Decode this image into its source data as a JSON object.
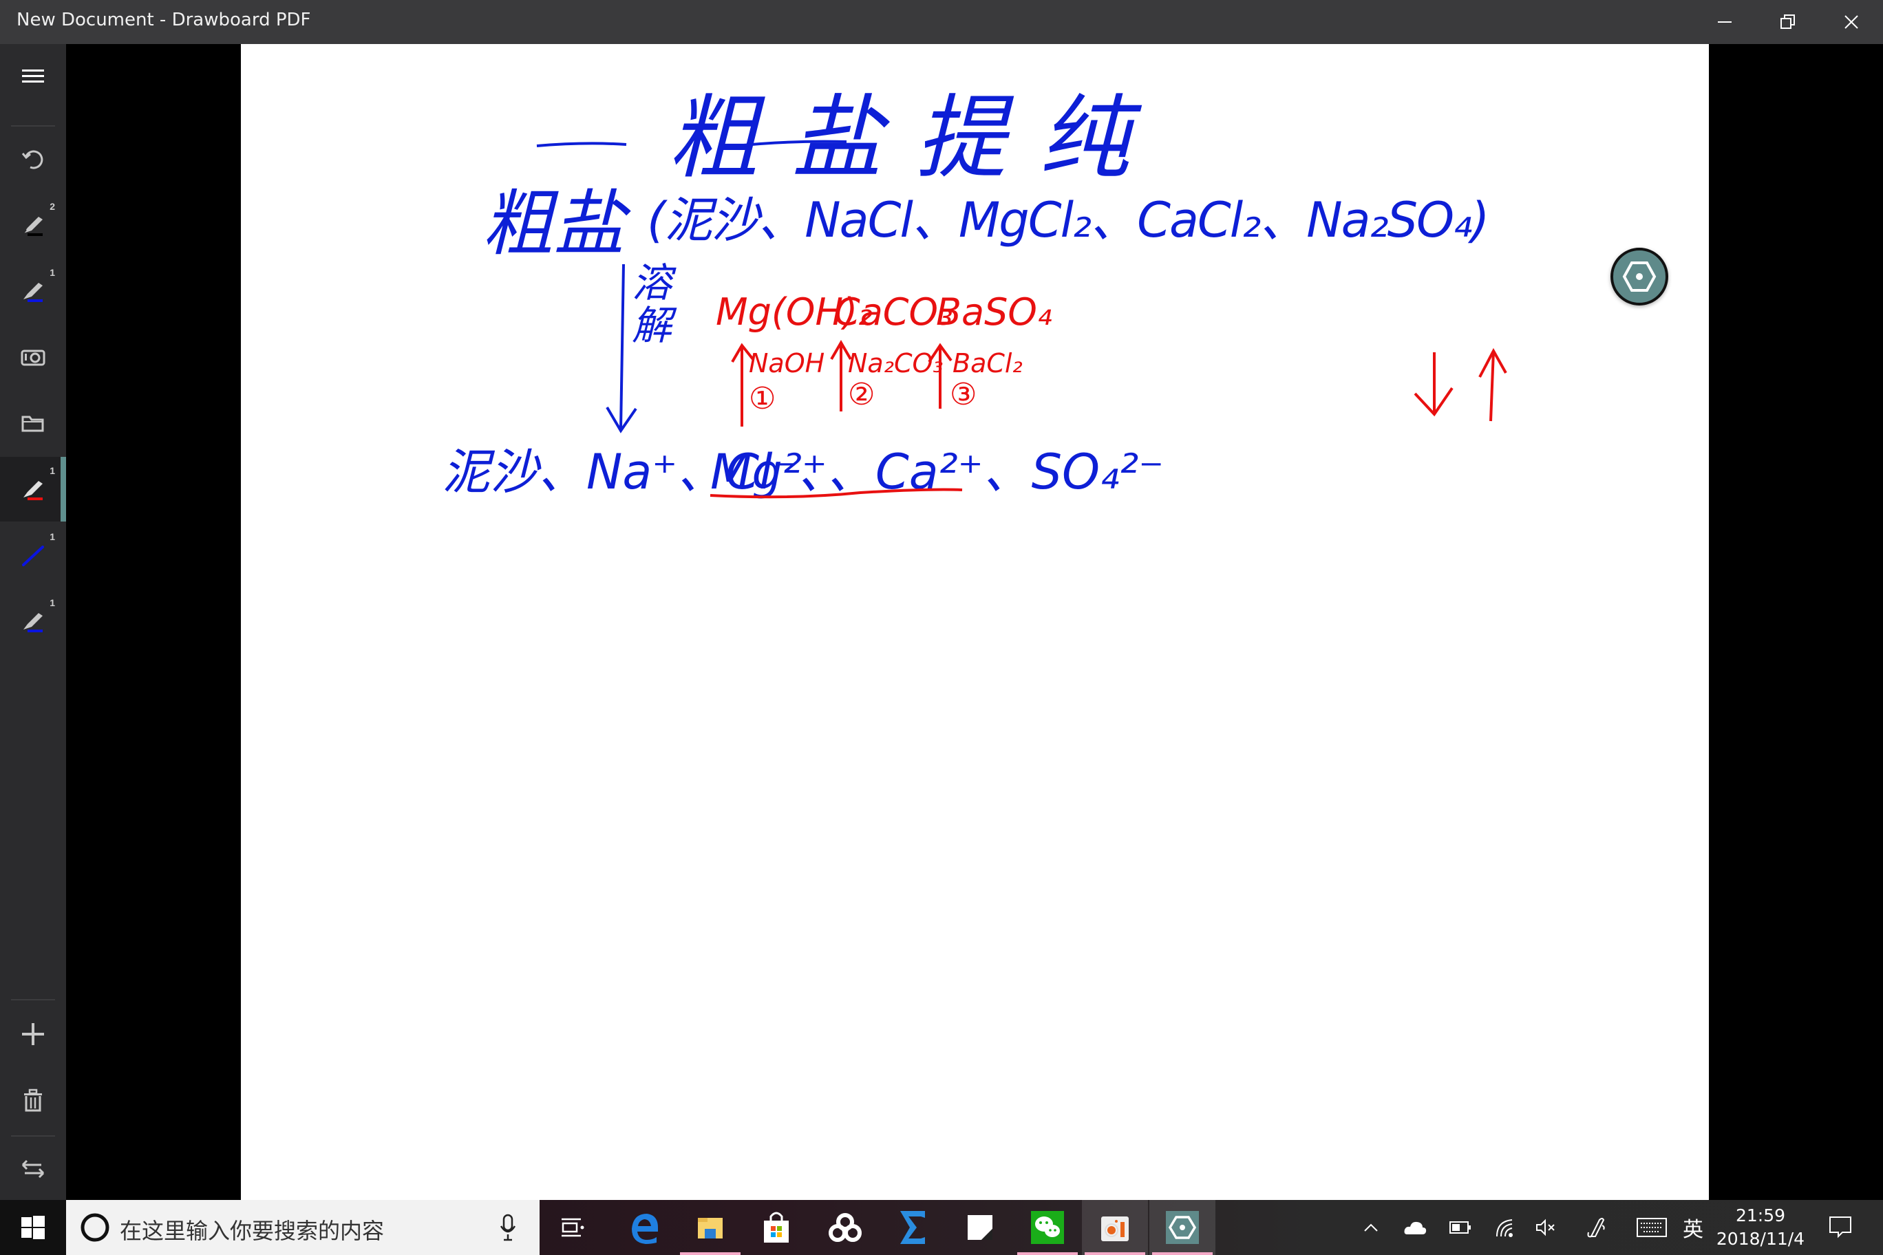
{
  "window": {
    "title": "New Document - Drawboard PDF",
    "controls": {
      "minimize": "minimize",
      "restore": "restore",
      "close": "close"
    }
  },
  "sidebar": {
    "items": [
      {
        "name": "menu",
        "icon": "hamburger-menu-icon",
        "badge": null
      },
      {
        "name": "undo",
        "icon": "undo-icon",
        "badge": null
      },
      {
        "name": "pen-black",
        "icon": "pen-icon",
        "color": "#000000",
        "badge": "2"
      },
      {
        "name": "pen-blue",
        "icon": "pen-icon",
        "color": "#0a14e0",
        "badge": "1"
      },
      {
        "name": "camera",
        "icon": "camera-icon",
        "badge": null
      },
      {
        "name": "open-folder",
        "icon": "folder-icon",
        "badge": null
      },
      {
        "name": "pen-red",
        "icon": "pen-icon",
        "color": "#e81010",
        "badge": "1",
        "selected": true
      },
      {
        "name": "line-blue",
        "icon": "line-icon",
        "color": "#0a14e0",
        "badge": "1"
      },
      {
        "name": "pen-blue-2",
        "icon": "pen-icon",
        "color": "#0a14e0",
        "badge": "1"
      },
      {
        "name": "add-page",
        "icon": "plus-icon",
        "badge": null
      },
      {
        "name": "delete",
        "icon": "trash-icon",
        "badge": null
      },
      {
        "name": "swap",
        "icon": "swap-arrows-icon",
        "badge": null
      }
    ]
  },
  "canvas": {
    "ink_colors": {
      "blue": "#0d1fd6",
      "red": "#e81010"
    },
    "handwriting": {
      "title": "粗盐提纯",
      "line1_label": "粗盐",
      "line1_content": "(泥沙、NaCl、MgCl₂、CaCl₂、Na₂SO₄)",
      "step_label": "溶解",
      "ions_line": {
        "prefix": "泥沙、Na⁺、Cl⁻、",
        "underlined": "Mg²⁺、Ca²⁺、SO₄²⁻"
      },
      "precipitates": [
        "Mg(OH)₂",
        "CaCO₃",
        "BaSO₄"
      ],
      "reagents": [
        {
          "formula": "NaOH",
          "step": "①"
        },
        {
          "formula": "Na₂CO₃",
          "step": "②"
        },
        {
          "formula": "BaCl₂",
          "step": "③"
        }
      ],
      "legend_arrows": [
        "↓",
        "↑"
      ]
    },
    "floating_button": {
      "icon": "hexagon-dot-icon",
      "color": "#5f8a8a"
    }
  },
  "taskbar": {
    "search_placeholder": "在这里输入你要搜索的内容",
    "apps": [
      {
        "name": "task-view",
        "icon": "task-view-icon"
      },
      {
        "name": "edge",
        "icon": "edge-icon"
      },
      {
        "name": "file-explorer",
        "icon": "folder-icon",
        "running": true
      },
      {
        "name": "store",
        "icon": "store-bag-icon"
      },
      {
        "name": "baidu-netdisk",
        "icon": "cloud-knot-icon"
      },
      {
        "name": "sigma",
        "icon": "sigma-icon"
      },
      {
        "name": "sticky",
        "icon": "sticky-note-icon"
      },
      {
        "name": "wechat",
        "icon": "wechat-icon",
        "running": true
      },
      {
        "name": "screen-recorder",
        "icon": "camera-record-icon",
        "running": true,
        "active": true
      },
      {
        "name": "drawboard",
        "icon": "hexagon-dot-icon",
        "running": true,
        "active": true
      }
    ],
    "tray": {
      "ime": "英",
      "time": "21:59",
      "date": "2018/11/4"
    }
  }
}
